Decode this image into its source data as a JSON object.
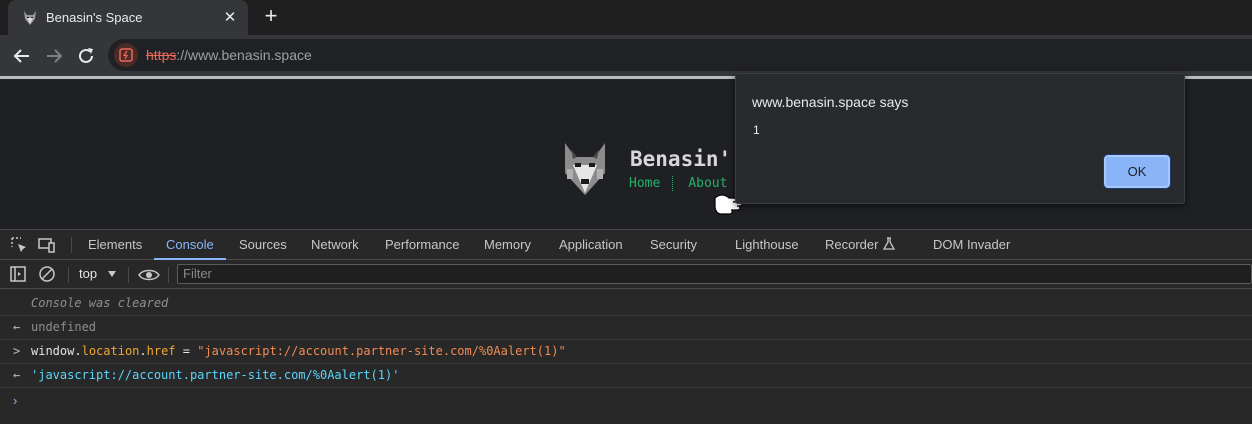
{
  "browser": {
    "tab": {
      "title": "Benasin's Space",
      "close": "✕"
    },
    "new_tab": "+",
    "url": {
      "scheme": "https",
      "rest": "://www.benasin.space"
    }
  },
  "page": {
    "site_title": "Benasin'",
    "nav": [
      "Home",
      "About"
    ]
  },
  "dialog": {
    "title": "www.benasin.space says",
    "message": "1",
    "ok_label": "OK"
  },
  "devtools": {
    "tabs": [
      "Elements",
      "Console",
      "Sources",
      "Network",
      "Performance",
      "Memory",
      "Application",
      "Security",
      "Lighthouse",
      "Recorder",
      "DOM Invader"
    ],
    "active_tab": "Console",
    "context": "top",
    "filter_placeholder": "Filter",
    "console": {
      "cleared": "Console was cleared",
      "result1": "undefined",
      "input": {
        "obj": "window",
        "prop1": "location",
        "prop2": "href",
        "op": " = ",
        "value": "\"javascript://account.partner-site.com/%0Aalert(1)\""
      },
      "result2": "'javascript://account.partner-site.com/%0Aalert(1)'"
    }
  }
}
